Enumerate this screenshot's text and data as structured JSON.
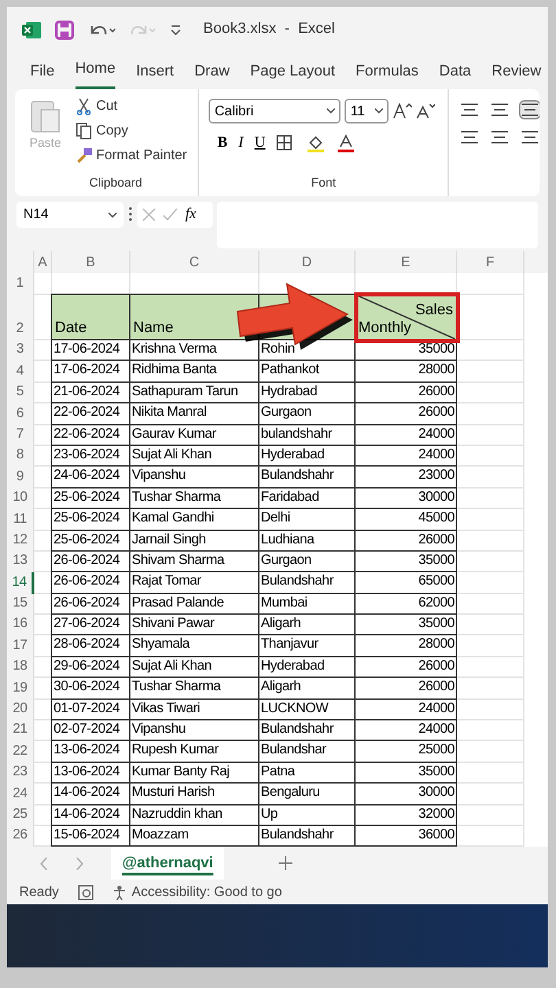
{
  "window": {
    "title": "Book3.xlsx  -  Excel"
  },
  "menu_tabs": [
    {
      "label": "File",
      "selected": false
    },
    {
      "label": "Home",
      "selected": true
    },
    {
      "label": "Insert",
      "selected": false
    },
    {
      "label": "Draw",
      "selected": false
    },
    {
      "label": "Page Layout",
      "selected": false
    },
    {
      "label": "Formulas",
      "selected": false
    },
    {
      "label": "Data",
      "selected": false
    },
    {
      "label": "Review",
      "selected": false
    }
  ],
  "ribbon": {
    "clipboard": {
      "paste": {
        "label": "Paste",
        "disabled": true
      },
      "actions": [
        "Cut",
        "Copy",
        "Format Painter"
      ],
      "label": "Clipboard"
    },
    "font": {
      "font_name": "Calibri",
      "font_size": "11",
      "styles": [
        "B",
        "I",
        "U"
      ],
      "label": "Font"
    }
  },
  "formula_bar": {
    "name_box": "N14",
    "fx": "fx"
  },
  "columns": [
    "A",
    "B",
    "C",
    "D",
    "E",
    "F"
  ],
  "blank_row": {
    "row": "1"
  },
  "header_row": {
    "row": "2",
    "date": "Date",
    "name": "Name",
    "sales_top": "Sales",
    "sales_bottom": "Monthly"
  },
  "rows": [
    {
      "row": "3",
      "date": "17-06-2024",
      "name": "Krishna Verma",
      "city": "Rohin",
      "amount": "35000"
    },
    {
      "row": "4",
      "date": "17-06-2024",
      "name": "Ridhima Banta",
      "city": "Pathankot",
      "amount": "28000"
    },
    {
      "row": "5",
      "date": "21-06-2024",
      "name": "Sathapuram Tarun",
      "city": "Hydrabad",
      "amount": "26000"
    },
    {
      "row": "6",
      "date": "22-06-2024",
      "name": "Nikita Manral",
      "city": "Gurgaon",
      "amount": "26000"
    },
    {
      "row": "7",
      "date": "22-06-2024",
      "name": "Gaurav Kumar",
      "city": "bulandshahr",
      "amount": "24000"
    },
    {
      "row": "8",
      "date": "23-06-2024",
      "name": "Sujat Ali Khan",
      "city": "Hyderabad",
      "amount": "24000"
    },
    {
      "row": "9",
      "date": "24-06-2024",
      "name": "Vipanshu",
      "city": "Bulandshahr",
      "amount": "23000"
    },
    {
      "row": "10",
      "date": "25-06-2024",
      "name": "Tushar Sharma",
      "city": "Faridabad",
      "amount": "30000"
    },
    {
      "row": "11",
      "date": "25-06-2024",
      "name": "Kamal Gandhi",
      "city": "Delhi",
      "amount": "45000"
    },
    {
      "row": "12",
      "date": "25-06-2024",
      "name": "Jarnail Singh",
      "city": "Ludhiana",
      "amount": "26000"
    },
    {
      "row": "13",
      "date": "26-06-2024",
      "name": "Shivam Sharma",
      "city": "Gurgaon",
      "amount": "35000"
    },
    {
      "row": "14",
      "date": "26-06-2024",
      "name": "Rajat Tomar",
      "city": "Bulandshahr",
      "amount": "65000",
      "selected": true
    },
    {
      "row": "15",
      "date": "26-06-2024",
      "name": "Prasad Palande",
      "city": "Mumbai",
      "amount": "62000"
    },
    {
      "row": "16",
      "date": "27-06-2024",
      "name": "Shivani Pawar",
      "city": "Aligarh",
      "amount": "35000"
    },
    {
      "row": "17",
      "date": "28-06-2024",
      "name": "Shyamala",
      "city": "Thanjavur",
      "amount": "28000"
    },
    {
      "row": "18",
      "date": "29-06-2024",
      "name": "Sujat Ali Khan",
      "city": "Hyderabad",
      "amount": "26000"
    },
    {
      "row": "19",
      "date": "30-06-2024",
      "name": "Tushar Sharma",
      "city": "Aligarh",
      "amount": "26000"
    },
    {
      "row": "20",
      "date": "01-07-2024",
      "name": "Vikas Tiwari",
      "city": "LUCKNOW",
      "amount": "24000"
    },
    {
      "row": "21",
      "date": "02-07-2024",
      "name": "Vipanshu",
      "city": "Bulandshahr",
      "amount": "24000"
    },
    {
      "row": "22",
      "date": "13-06-2024",
      "name": "Rupesh Kumar",
      "city": "Bulandshar",
      "amount": "25000"
    },
    {
      "row": "23",
      "date": "13-06-2024",
      "name": "Kumar Banty Raj",
      "city": "Patna",
      "amount": "35000"
    },
    {
      "row": "24",
      "date": "14-06-2024",
      "name": "Musturi Harish",
      "city": "Bengaluru",
      "amount": "30000"
    },
    {
      "row": "25",
      "date": "14-06-2024",
      "name": "Nazruddin khan",
      "city": "Up",
      "amount": "32000"
    },
    {
      "row": "26",
      "date": "15-06-2024",
      "name": "Moazzam",
      "city": "Bulandshahr",
      "amount": "36000"
    }
  ],
  "sheet_tabs": [
    {
      "label": "@athernaqvi",
      "selected": true
    }
  ],
  "status_bar": {
    "ready": "Ready",
    "accessibility": "Accessibility: Good to go"
  }
}
